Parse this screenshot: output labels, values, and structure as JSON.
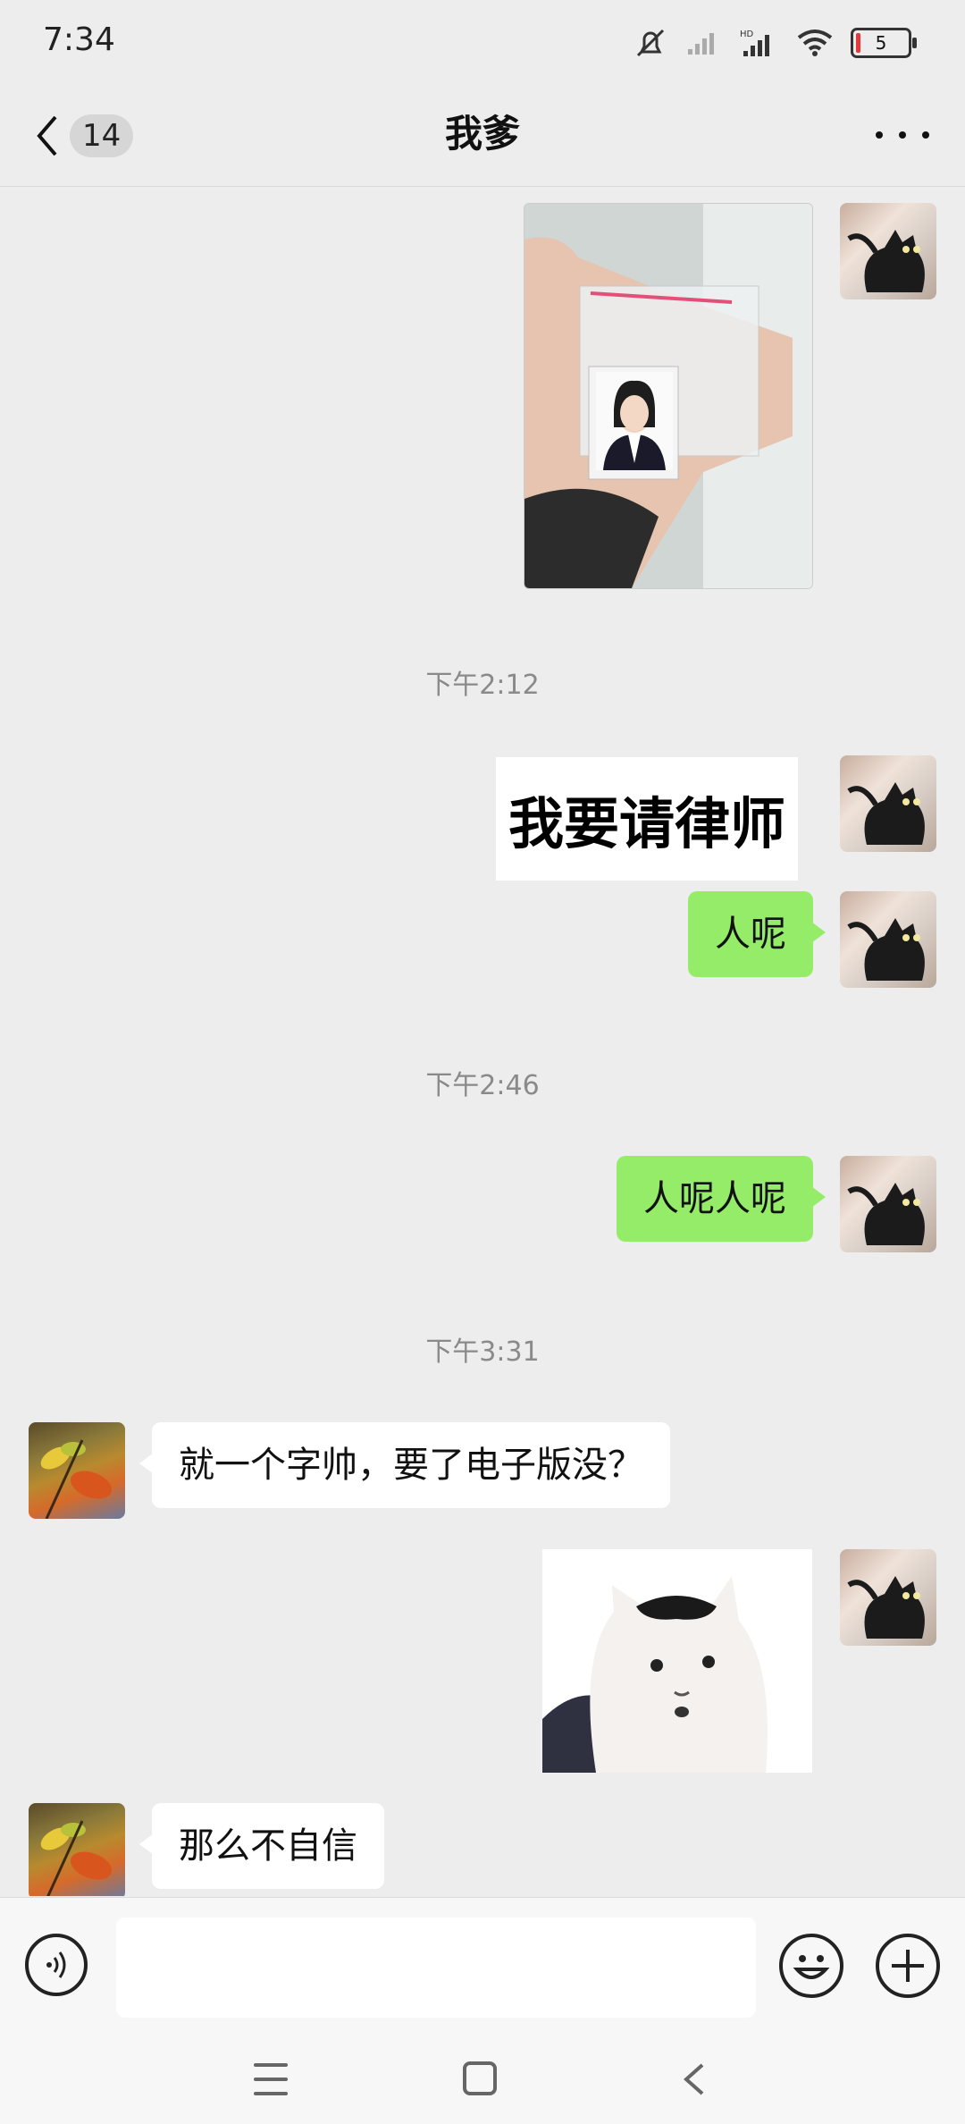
{
  "status": {
    "time": "7:34",
    "battery": "5",
    "network": "HD"
  },
  "header": {
    "back_count": "14",
    "title": "我爹"
  },
  "chat": {
    "timestamps": [
      "下午2:12",
      "下午2:46",
      "下午3:31"
    ],
    "messages": {
      "sticker_text": "我要请律师",
      "sent_1": "人呢",
      "sent_2": "人呢人呢",
      "recv_1": "就一个字帅，要了电子版没？",
      "recv_2": "那么不自信"
    }
  },
  "input": {
    "placeholder": ""
  },
  "icons": {
    "back": "chevron-left-icon",
    "more": "more-dots-icon",
    "voice": "voice-icon",
    "emoji": "emoji-icon",
    "plus": "plus-icon"
  },
  "colors": {
    "sent_bubble": "#95ec69",
    "recv_bubble": "#ffffff",
    "background": "#ededed"
  }
}
